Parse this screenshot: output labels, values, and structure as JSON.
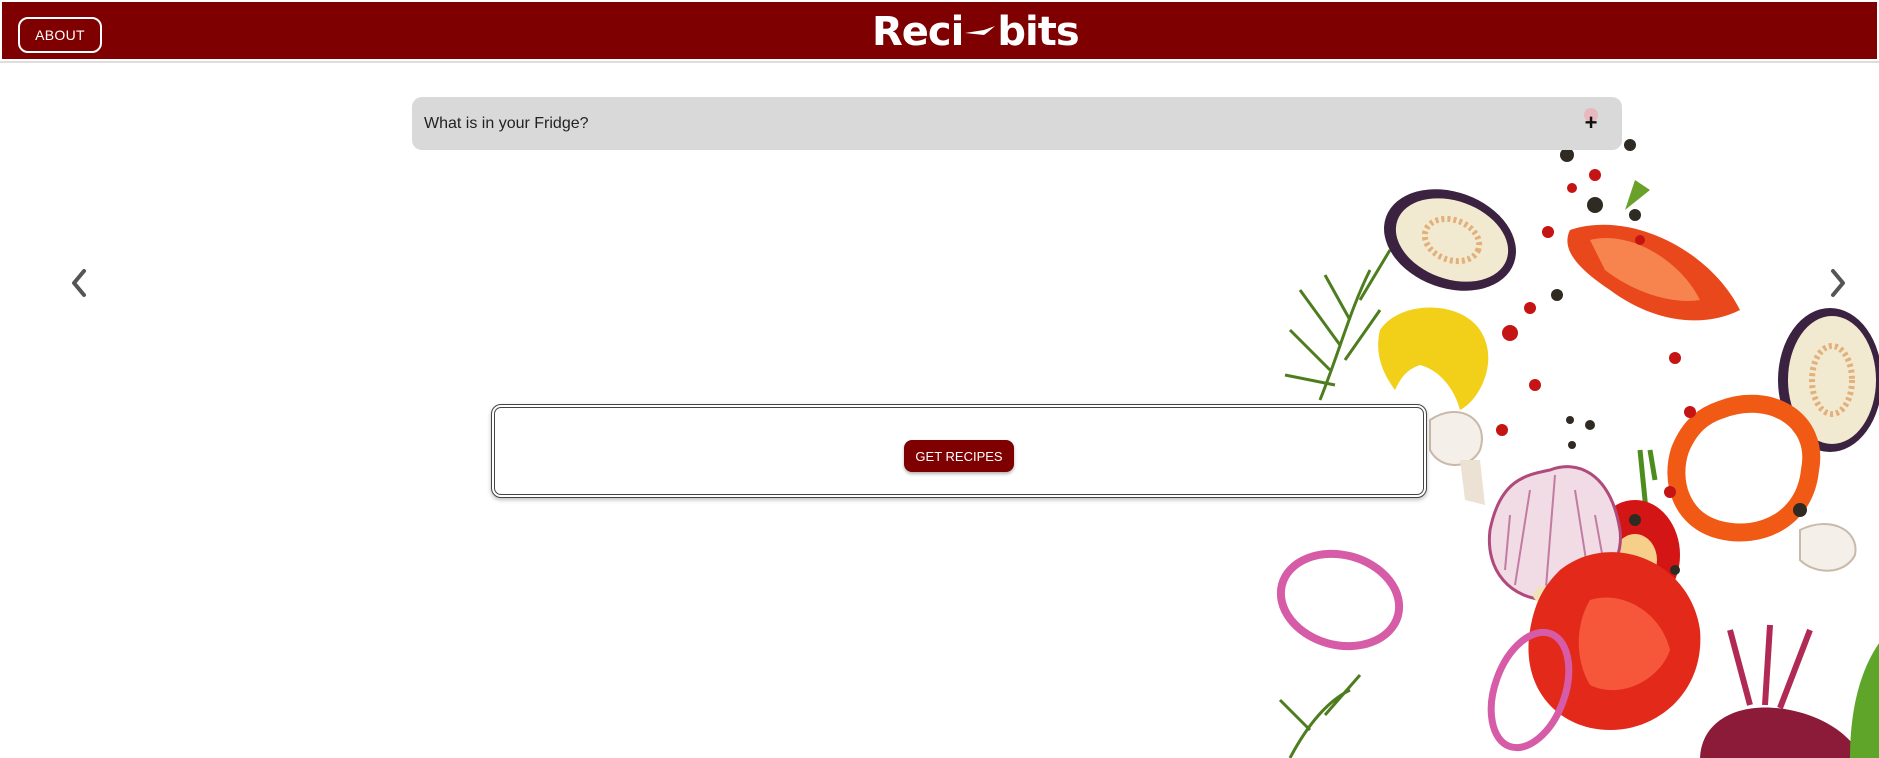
{
  "header": {
    "about_label": "ABOUT",
    "logo_text_left": "Reci",
    "logo_text_right": "bits",
    "logo_icon": "knife-icon",
    "bg_color": "#7f0000"
  },
  "fridge": {
    "label": "What is in your Fridge?",
    "expand_icon": "plus-icon",
    "expand_glyph": "+",
    "bg_color": "#d9d9d9"
  },
  "carousel": {
    "prev_icon": "chevron-left-icon",
    "next_icon": "chevron-right-icon"
  },
  "recipes": {
    "button_label": "GET RECIPES",
    "button_color": "#7f0000"
  },
  "decoration": {
    "image": "vegetables-illustration"
  }
}
